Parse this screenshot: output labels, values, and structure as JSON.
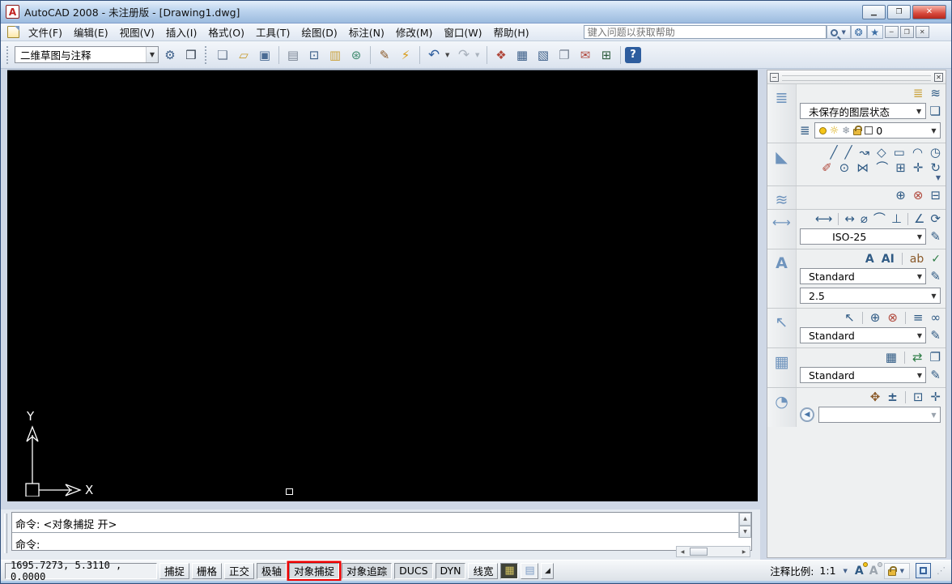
{
  "window": {
    "title": "AutoCAD 2008 - 未注册版 - [Drawing1.dwg]"
  },
  "menu": {
    "items": [
      "文件(F)",
      "编辑(E)",
      "视图(V)",
      "插入(I)",
      "格式(O)",
      "工具(T)",
      "绘图(D)",
      "标注(N)",
      "修改(M)",
      "窗口(W)",
      "帮助(H)"
    ],
    "search_placeholder": "键入问题以获取帮助"
  },
  "toolbar": {
    "workspace_selected": "二维草图与注释"
  },
  "canvas": {
    "ucs_y_label": "Y",
    "ucs_x_label": "X"
  },
  "dashboard": {
    "layers": {
      "layer_state": "未保存的图层状态",
      "current_layer": "0"
    },
    "dimensions": {
      "style": "ISO-25"
    },
    "text": {
      "style": "Standard",
      "height": "2.5"
    },
    "multileader": {
      "style": "Standard"
    },
    "tables": {
      "style": "Standard"
    },
    "navigate": {
      "position_value": ""
    }
  },
  "command": {
    "history_line": "命令:  <对象捕捉 开>",
    "prompt": "命令:"
  },
  "statusbar": {
    "coordinates": "1695.7273, 5.3110 , 0.0000",
    "toggles": [
      {
        "label": "捕捉",
        "active": false,
        "highlighted": false
      },
      {
        "label": "栅格",
        "active": false,
        "highlighted": false
      },
      {
        "label": "正交",
        "active": false,
        "highlighted": false
      },
      {
        "label": "极轴",
        "active": true,
        "highlighted": false
      },
      {
        "label": "对象捕捉",
        "active": true,
        "highlighted": true
      },
      {
        "label": "对象追踪",
        "active": true,
        "highlighted": false
      },
      {
        "label": "DUCS",
        "active": true,
        "highlighted": false
      },
      {
        "label": "DYN",
        "active": true,
        "highlighted": false
      },
      {
        "label": "线宽",
        "active": false,
        "highlighted": false
      }
    ],
    "annotation_scale_label": "注释比例:",
    "annotation_scale_value": "1:1"
  },
  "icons": {
    "app-logo": "A",
    "minimize": "▁",
    "maximize": "❐",
    "close": "✕",
    "search-dropdown": "▼",
    "comm-center": "❂",
    "favorites-star": "★",
    "mdi-minimize": "─",
    "mdi-restore": "❐",
    "mdi-close": "✕",
    "workspace-gear": "⚙",
    "my-workspace": "❒",
    "file-new": "❏",
    "folder-open": "▱",
    "save": "▣",
    "plot": "▤",
    "plot-preview": "⊡",
    "publish": "▥",
    "dwf": "⊛",
    "matchprop": "✎",
    "quick-edit": "⚡",
    "undo": "↶",
    "redo": "↷",
    "dropdown": "▼",
    "properties": "❖",
    "designcenter": "▦",
    "toolpalettes": "▧",
    "sheetset": "❐",
    "markupset": "✉",
    "quickcalc": "⊞",
    "help": "?",
    "layers-panel": "≣",
    "layer-props": "≣",
    "layer-isolate": "≋",
    "layer-states-mgr": "❏",
    "layer-prev": "≣",
    "freeze": "❄",
    "draw-panel": "◣",
    "line": "╱",
    "construction-line": "╱",
    "polyline": "↝",
    "polygon": "◇",
    "rectangle": "▭",
    "arc": "◠",
    "circle": "◷",
    "erase": "✐",
    "copy": "⊙",
    "mirror": "⋈",
    "fillet": "⌒",
    "array": "⊞",
    "move": "✛",
    "rotate": "↻",
    "scales-panel": "≋",
    "scale-add": "⊕",
    "scale-delete": "⊗",
    "scale-sync": "⊟",
    "dim-panel": "⟷",
    "dim-linear": "⟷",
    "dim-aligned": "↔",
    "dim-radius": "⌀",
    "dim-arc": "⌒",
    "dim-ordinate": "⊥",
    "dim-angular": "∠",
    "dim-jogged": "⟳",
    "dim-style-edit": "✎",
    "text-panel": "A",
    "mtext": "A",
    "dtext": "AI",
    "text-find": "ab",
    "text-spell": "✓",
    "text-style-edit": "✎",
    "mleader-panel": "↖",
    "mleader": "↖",
    "mleader-add": "⊕",
    "mleader-remove": "⊗",
    "mleader-align": "≡",
    "mleader-collect": "∞",
    "mleader-style-edit": "✎",
    "table-panel": "▦",
    "table-new": "▦",
    "table-datalink": "⇄",
    "table-cell": "❐",
    "table-style-edit": "✎",
    "nav-panel": "◔",
    "pan": "✥",
    "zoom-realtime": "±",
    "zoom-window": "⊡",
    "zoom-extents": "✛",
    "nav-back": "◀",
    "up-arrow": "▲",
    "down-arrow": "▼",
    "left-arrow": "◀",
    "right-arrow": "▶",
    "model-tab": "▦",
    "layout-tab": "▤",
    "mp-toggle": "◢",
    "annot-vis": "A",
    "annot-auto": "A",
    "grip-dots": "⋰"
  }
}
